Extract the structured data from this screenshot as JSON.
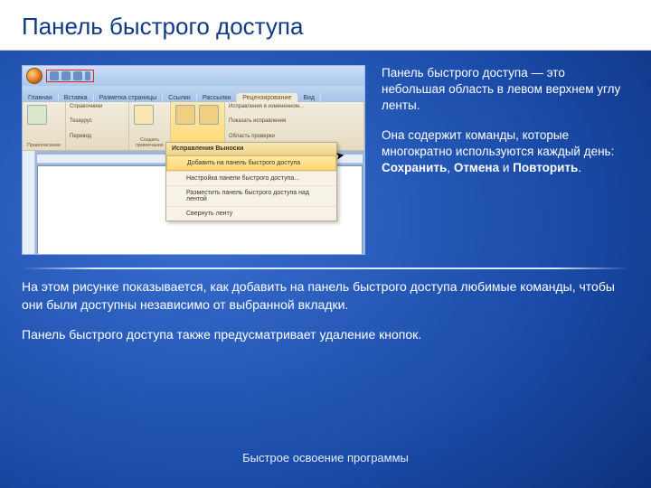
{
  "slide": {
    "title": "Панель быстрого доступа",
    "para1_pre": "Панель быстрого доступа — это небольшая область в левом верхнем углу ленты.",
    "para2_pre": "Она содержит команды, которые многократно используются каждый день: ",
    "bold1": "Сохранить",
    "sep1": ", ",
    "bold2": "Отмена",
    "sep2": " и ",
    "bold3": "Повторить",
    "period": ".",
    "para3": "На этом рисунке показывается, как добавить на панель быстрого доступа любимые команды, чтобы они были доступны независимо от выбранной вкладки.",
    "para4": "Панель быстрого доступа также предусматривает удаление кнопок.",
    "footer": "Быстрое освоение программы"
  },
  "word": {
    "tabs": [
      "Главная",
      "Вставка",
      "Разметка страницы",
      "Ссылки",
      "Рассылки",
      "Рецензирование",
      "Вид"
    ],
    "active_tab_index": 5,
    "groups": {
      "g1": "Правописание",
      "g1a": "Справочники",
      "g1b": "Тезаурус",
      "g1c": "Перевод",
      "g2": "Создать примечание",
      "g3": "Исправления",
      "g3a": "Выноски",
      "g3b": "Исправления в измененном...",
      "g3c": "Показать исправления",
      "g3d": "Область проверки"
    },
    "context_menu": {
      "header": "Исправления  Выноски",
      "items": [
        "Добавить на панель быстрого доступа",
        "Настройка панели быстрого доступа...",
        "Разместить панель быстрого доступа над лентой",
        "Свернуть ленту"
      ],
      "highlighted_index": 0
    }
  }
}
